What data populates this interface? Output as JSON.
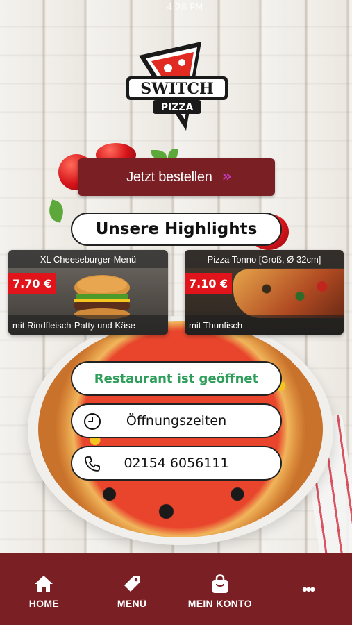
{
  "status_bar": {
    "time": "4:28 PM"
  },
  "brand": {
    "name_line1": "SWITCH",
    "name_line2": "PIZZA"
  },
  "order_button": {
    "label": "Jetzt bestellen",
    "chevron": "»"
  },
  "highlights": {
    "heading": "Unsere Highlights",
    "cards": [
      {
        "title": "XL Cheeseburger-Menü",
        "price": "7.70 €",
        "subtitle": "mit Rindfleisch-Patty und Käse"
      },
      {
        "title": "Pizza Tonno [Groß, Ø 32cm]",
        "price": "7.10 €",
        "subtitle": "mit Thunfisch"
      }
    ]
  },
  "status": {
    "label": "Restaurant ist geöffnet"
  },
  "hours": {
    "label": "Öffnungszeiten",
    "icon": "clock-icon"
  },
  "phone": {
    "label": "02154 6056111",
    "icon": "phone-icon"
  },
  "nav": {
    "items": [
      {
        "label": "HOME",
        "icon": "home-icon"
      },
      {
        "label": "MENÜ",
        "icon": "tag-icon"
      },
      {
        "label": "MEIN KONTO",
        "icon": "bag-icon"
      },
      {
        "label": "•••",
        "icon": "more-icon"
      }
    ]
  },
  "colors": {
    "brand": "#7a1f24",
    "open_green": "#2e9e5a",
    "price_red": "#e0141a",
    "chevron": "#c23dbb"
  }
}
